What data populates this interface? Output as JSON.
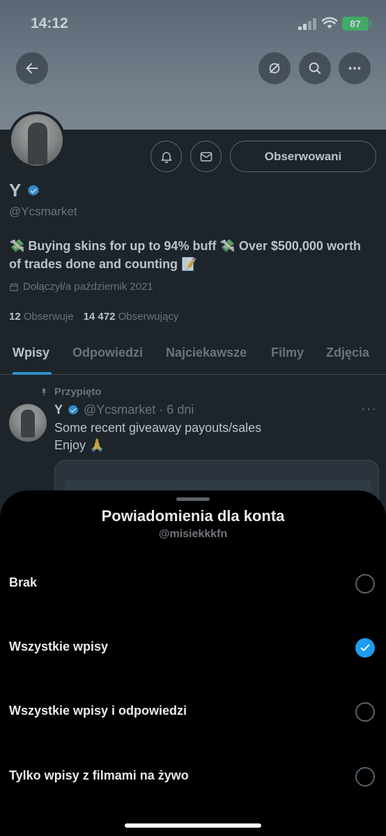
{
  "status_bar": {
    "time": "14:12",
    "battery": "87"
  },
  "profile": {
    "name": "Y",
    "handle": "@Ycsmarket",
    "bio": "💸 Buying skins for up to 94% buff 💸 Over $500,000 worth of trades done and counting 📝",
    "joined": "Dołączył/a październik 2021",
    "following_count": "12",
    "following_label": "Obserwuje",
    "followers_count": "14 472",
    "followers_label": "Obserwujący",
    "follow_button": "Obserwowani"
  },
  "tabs": [
    {
      "label": "Wpisy",
      "active": true
    },
    {
      "label": "Odpowiedzi",
      "active": false
    },
    {
      "label": "Najciekawsze",
      "active": false
    },
    {
      "label": "Filmy",
      "active": false
    },
    {
      "label": "Zdjęcia",
      "active": false
    }
  ],
  "pinned_tweet": {
    "pinned_label": "Przypięto",
    "name": "Y",
    "handle_time": "@Ycsmarket · 6 dni",
    "line1": "Some recent giveaway payouts/sales",
    "line2": "Enjoy 🙏"
  },
  "sheet": {
    "title": "Powiadomienia dla konta",
    "subtitle": "@misiekkkfn",
    "options": [
      {
        "label": "Brak",
        "selected": false
      },
      {
        "label": "Wszystkie wpisy",
        "selected": true
      },
      {
        "label": "Wszystkie wpisy i odpowiedzi",
        "selected": false
      },
      {
        "label": "Tylko wpisy z filmami na żywo",
        "selected": false
      }
    ]
  },
  "colors": {
    "accent": "#1d9bf0",
    "background": "#000000",
    "secondary_text": "#71767b",
    "battery": "#35c759"
  }
}
